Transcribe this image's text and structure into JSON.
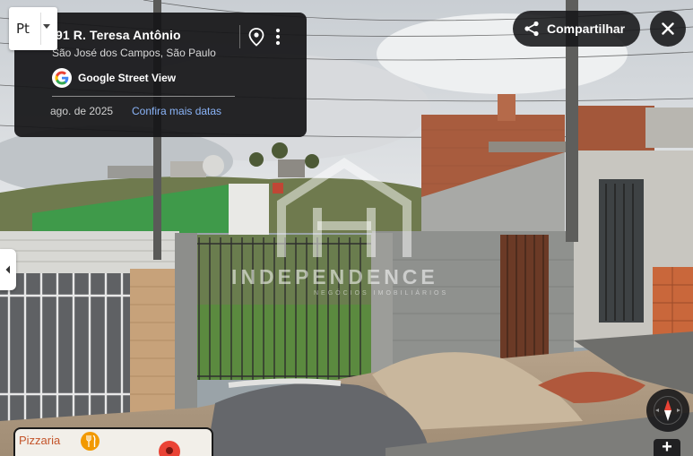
{
  "language_button": {
    "label": "Pt"
  },
  "location": {
    "title": "91 R. Teresa Antônio",
    "subtitle": "São José dos Campos, São Paulo"
  },
  "provider": {
    "label": "Google Street View"
  },
  "capture": {
    "date": "ago. de 2025",
    "more_dates_link": "Confira mais datas"
  },
  "share_button": {
    "label": "Compartilhar"
  },
  "watermark": {
    "brand": "INDEPENDENCE",
    "tagline": "NEGÓCIOS IMOBILIÁRIOS"
  },
  "minimap": {
    "poi_label": "Pizzaria",
    "poi_icon": "restaurant-icon",
    "marker": "red-pin-icon"
  },
  "icons": {
    "share": "share-icon",
    "close": "close-icon",
    "pin": "map-pin-icon",
    "more": "more-vert-icon",
    "google": "google-g-icon",
    "chevron": "chevron-left-icon",
    "compass": "compass-icon",
    "zoom": "plus-icon"
  },
  "colors": {
    "card_bg": "#161618",
    "link": "#8ab4f8",
    "poi": "#c4552b",
    "poi_icon": "#f29900",
    "marker": "#ea4335"
  }
}
